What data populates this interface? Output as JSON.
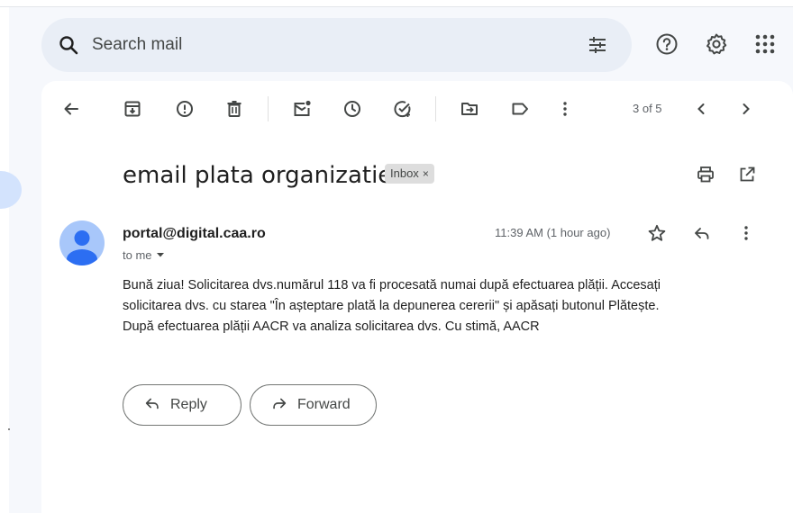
{
  "search": {
    "placeholder": "Search mail"
  },
  "toolbar": {
    "pager_text": "3 of 5"
  },
  "email": {
    "subject": "email plata organizatie",
    "label": "Inbox",
    "label_close": "×",
    "sender": "portal@digital.caa.ro",
    "recipient": "to me",
    "time": "11:39 AM (1 hour ago)",
    "body_line1": "Bună ziua! Solicitarea dvs.numărul 118 va fi procesată numai după efectuarea plății. Accesați",
    "body_line2": "solicitarea dvs. cu starea \"În așteptare plată la depunerea cererii\" și apăsați butonul Plătește.",
    "body_line3": "După efectuarea plății AACR va analiza solicitarea dvs. Cu stimă, AACR"
  },
  "actions": {
    "reply_label": "Reply",
    "forward_label": "Forward"
  },
  "icons": {
    "search": "search-icon",
    "tune": "tune-icon",
    "help": "help-icon",
    "settings": "settings-icon",
    "apps": "apps-icon",
    "back": "arrow-back-icon",
    "archive": "archive-icon",
    "spam": "report-spam-icon",
    "delete": "delete-icon",
    "unread": "mark-unread-icon",
    "snooze": "snooze-icon",
    "task": "add-task-icon",
    "move": "move-to-icon",
    "labels": "label-icon",
    "more": "more-vert-icon",
    "prev": "chevron-left-icon",
    "next": "chevron-right-icon",
    "print": "print-icon",
    "open_new": "open-new-window-icon",
    "star": "star-icon",
    "reply": "reply-icon"
  },
  "colors": {
    "background": "#f6f8fc",
    "search_bg": "#e9eef6",
    "avatar_bg": "#a8c7fa",
    "avatar_fg": "#2c6ef2",
    "label_bg": "#dddddd"
  }
}
